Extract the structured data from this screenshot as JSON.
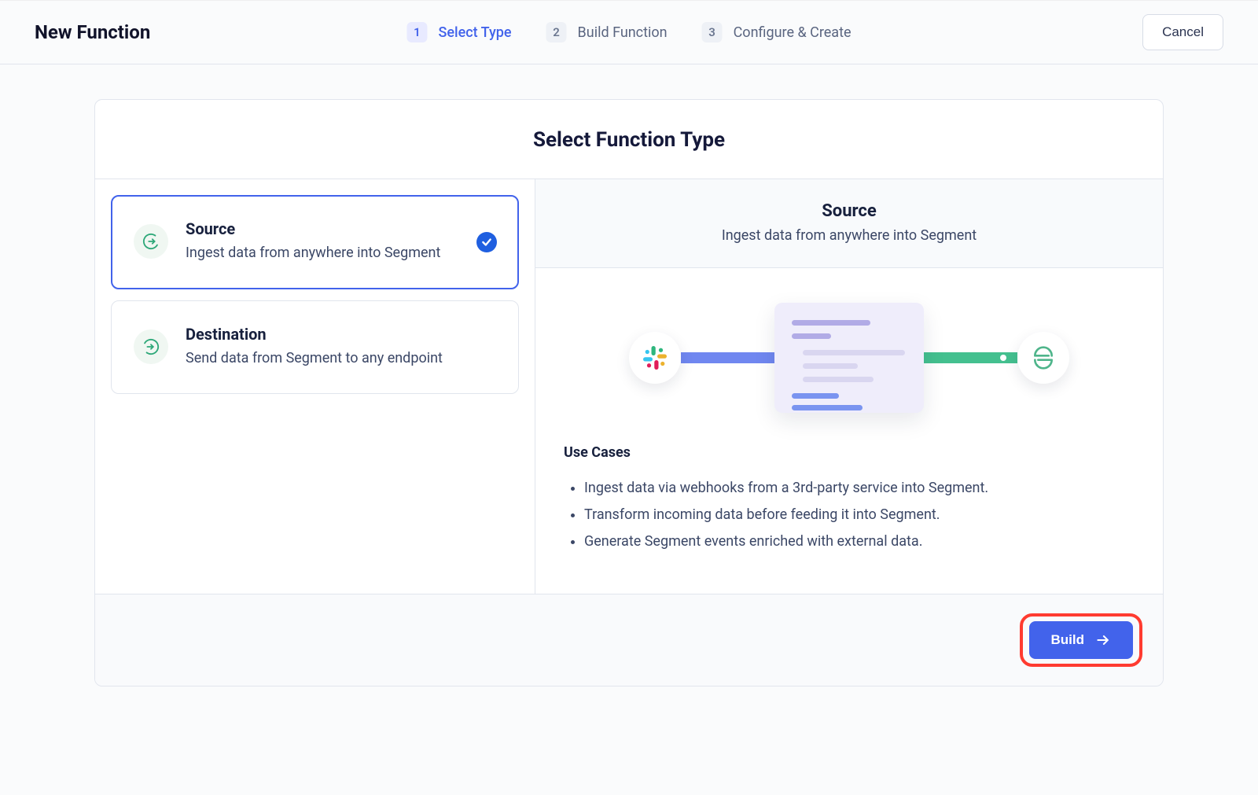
{
  "header": {
    "title": "New Function",
    "cancel_label": "Cancel"
  },
  "steps": [
    {
      "num": "1",
      "label": "Select Type",
      "active": true
    },
    {
      "num": "2",
      "label": "Build Function",
      "active": false
    },
    {
      "num": "3",
      "label": "Configure & Create",
      "active": false
    }
  ],
  "card": {
    "title": "Select Function Type"
  },
  "options": [
    {
      "id": "source",
      "title": "Source",
      "desc": "Ingest data from anywhere into Segment",
      "selected": true,
      "icon": "export-arrow-icon"
    },
    {
      "id": "destination",
      "title": "Destination",
      "desc": "Send data from Segment to any endpoint",
      "selected": false,
      "icon": "import-arrow-icon"
    }
  ],
  "detail": {
    "title": "Source",
    "subtitle": "Ingest data from anywhere into Segment",
    "use_cases_heading": "Use Cases",
    "use_cases": [
      "Ingest data via webhooks from a 3rd-party service into Segment.",
      "Transform incoming data before feeding it into Segment.",
      "Generate Segment events enriched with external data."
    ]
  },
  "footer": {
    "build_label": "Build"
  },
  "illustration": {
    "left_node": "slack-icon",
    "right_node": "segment-icon"
  }
}
